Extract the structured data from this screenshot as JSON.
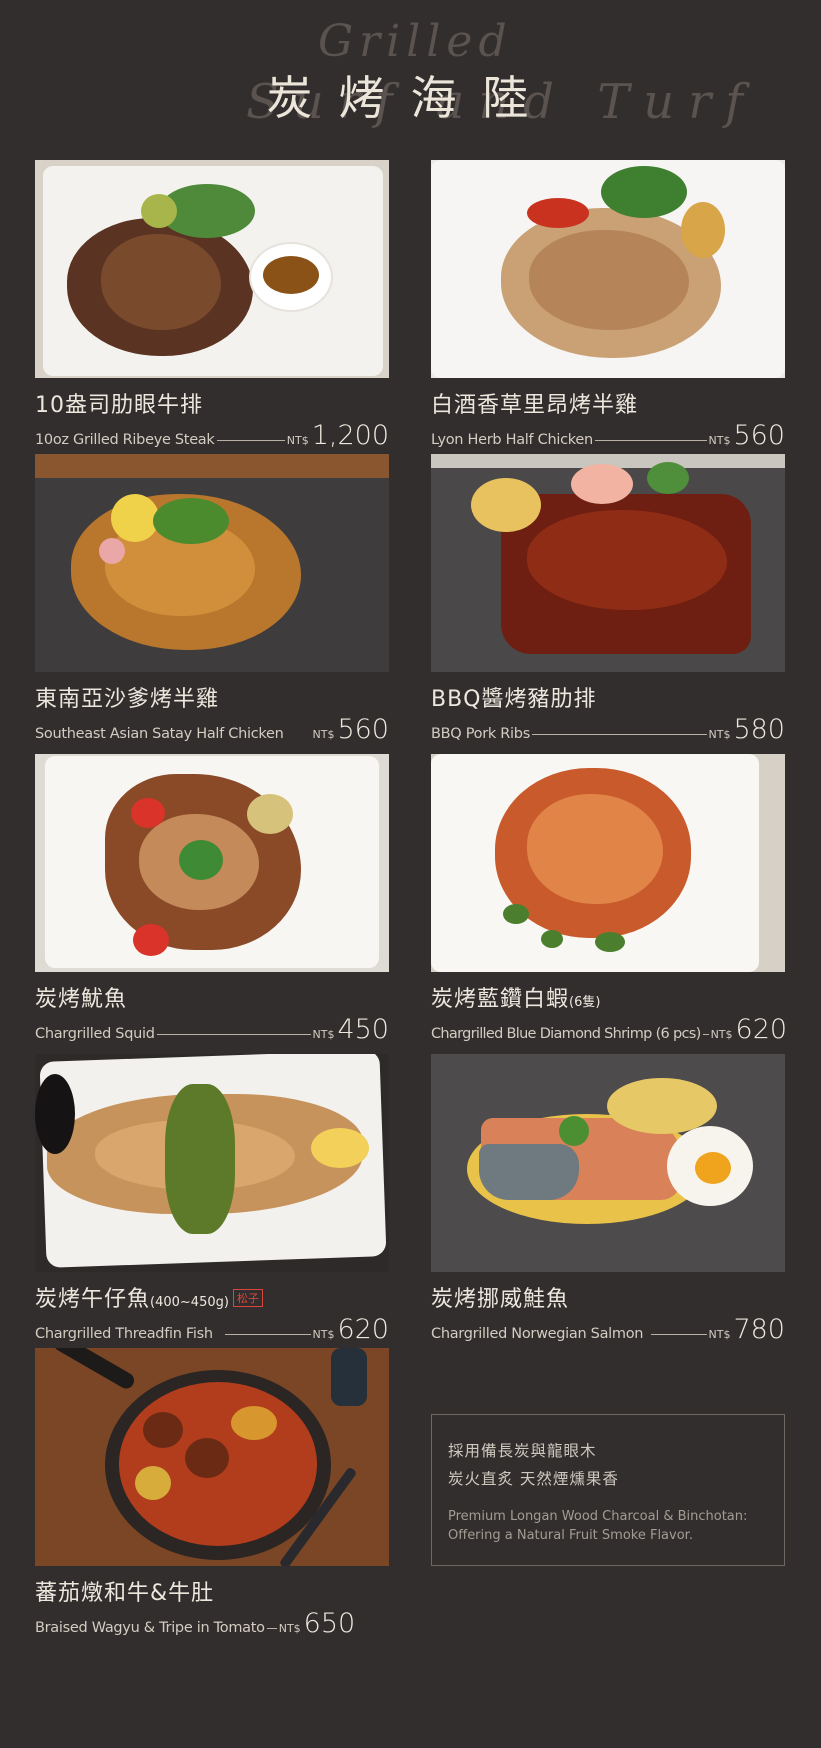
{
  "header": {
    "script_top": "Grilled",
    "script_bottom": "Surf and Turf",
    "title": "炭烤海陸"
  },
  "currency": "NT$",
  "items": [
    {
      "name_zh": "10盎司肋眼牛排",
      "name_zh_small": "",
      "tag": "",
      "name_en": "10oz Grilled Ribeye Steak",
      "price": "1,200",
      "photo": "ribeye-steak"
    },
    {
      "name_zh": "白酒香草里昂烤半雞",
      "name_zh_small": "",
      "tag": "",
      "name_en": "Lyon Herb Half Chicken",
      "price": "560",
      "photo": "herb-half-chicken"
    },
    {
      "name_zh": "東南亞沙爹烤半雞",
      "name_zh_small": "",
      "tag": "",
      "name_en": "Southeast Asian Satay Half Chicken",
      "price": "560",
      "photo": "satay-half-chicken"
    },
    {
      "name_zh": "BBQ醬烤豬肋排",
      "name_zh_small": "",
      "tag": "",
      "name_en": "BBQ Pork Ribs",
      "price": "580",
      "photo": "bbq-pork-ribs"
    },
    {
      "name_zh": "炭烤魷魚",
      "name_zh_small": "",
      "tag": "",
      "name_en": "Chargrilled Squid",
      "price": "450",
      "photo": "chargrilled-squid"
    },
    {
      "name_zh": "炭烤藍鑽白蝦",
      "name_zh_small": "(6隻)",
      "tag": "",
      "name_en": "Chargrilled Blue Diamond Shrimp (6 pcs)",
      "price": "620",
      "photo": "blue-diamond-shrimp"
    },
    {
      "name_zh": "炭烤午仔魚",
      "name_zh_small": "(400~450g)",
      "tag": "松子",
      "name_en": "Chargrilled Threadfin Fish",
      "price": "620",
      "photo": "threadfin-fish"
    },
    {
      "name_zh": "炭烤挪威鮭魚",
      "name_zh_small": "",
      "tag": "",
      "name_en": "Chargrilled Norwegian Salmon",
      "price": "780",
      "photo": "norwegian-salmon"
    },
    {
      "name_zh": "蕃茄燉和牛&牛肚",
      "name_zh_small": "",
      "tag": "",
      "name_en": "Braised Wagyu & Tripe in Tomato",
      "price": "650",
      "photo": "braised-wagyu-tripe"
    }
  ],
  "info": {
    "zh_line1": "採用備長炭與龍眼木",
    "zh_line2": "炭火直炙 天然煙燻果香",
    "en_line1": "Premium Longan Wood Charcoal & Binchotan:",
    "en_line2": "Offering a Natural Fruit Smoke Flavor."
  }
}
